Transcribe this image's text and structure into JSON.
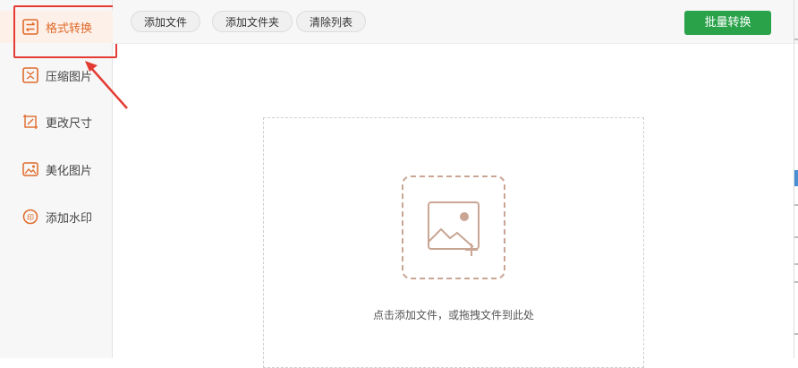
{
  "sidebar": {
    "items": [
      {
        "label": "格式转换",
        "icon": "format-convert-icon",
        "active": true
      },
      {
        "label": "压缩图片",
        "icon": "compress-image-icon",
        "active": false
      },
      {
        "label": "更改尺寸",
        "icon": "resize-icon",
        "active": false
      },
      {
        "label": "美化图片",
        "icon": "beautify-image-icon",
        "active": false
      },
      {
        "label": "添加水印",
        "icon": "watermark-icon",
        "active": false
      }
    ]
  },
  "toolbar": {
    "add_file": "添加文件",
    "add_folder": "添加文件夹",
    "clear_list": "清除列表",
    "batch_convert": "批量转换"
  },
  "dropzone": {
    "hint": "点击添加文件，或拖拽文件到此处",
    "icon": "add-image-icon"
  },
  "colors": {
    "accent": "#e06a2a",
    "primary_button": "#2aa24a",
    "highlight_box": "#e33b33",
    "annotation_arrow": "#e33b33"
  }
}
